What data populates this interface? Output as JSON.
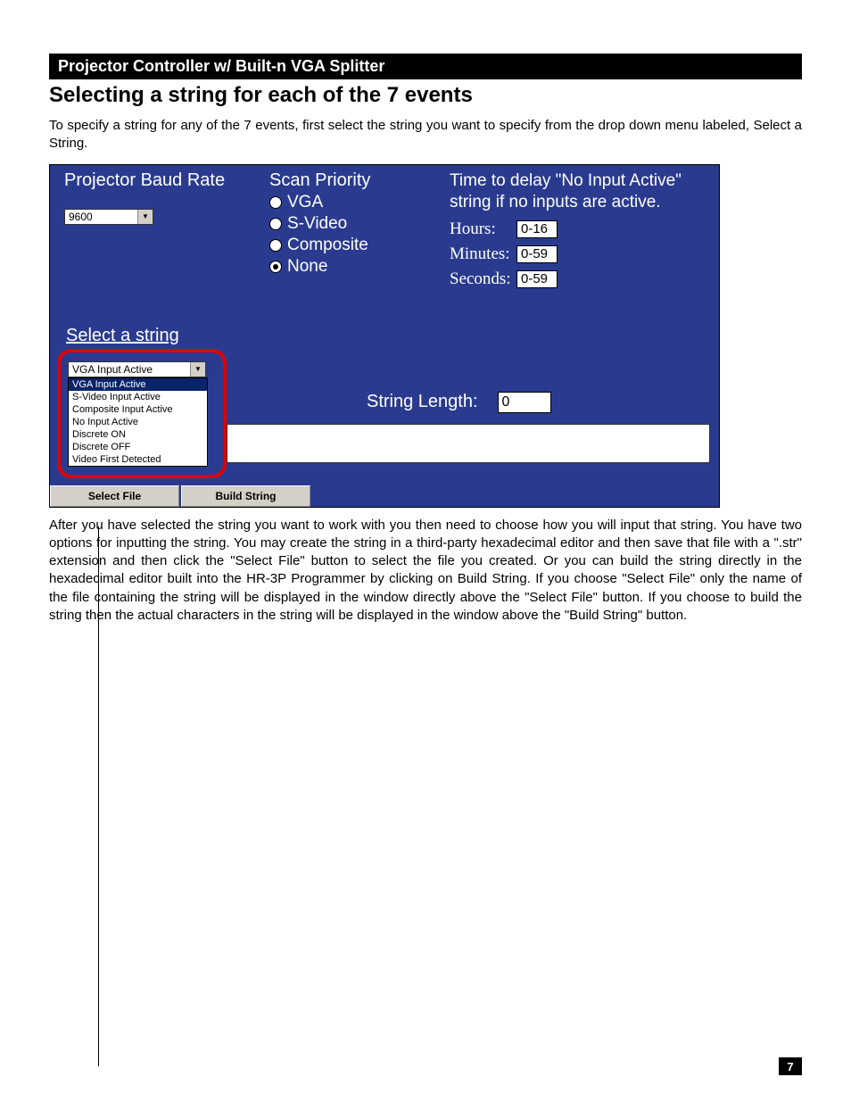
{
  "header": {
    "product_title": "Projector Controller w/ Built-n VGA Splitter",
    "section_heading": "Selecting a string for each of the 7 events"
  },
  "intro_paragraph": "To specify a string for any of the 7 events, first select the string you want to specify from the drop down menu labeled, Select a String.",
  "screenshot": {
    "baud": {
      "label": "Projector Baud Rate",
      "value": "9600"
    },
    "scan": {
      "title": "Scan Priority",
      "options": [
        {
          "label": "VGA",
          "selected": false
        },
        {
          "label": "S-Video",
          "selected": false
        },
        {
          "label": "Composite",
          "selected": false
        },
        {
          "label": "None",
          "selected": true
        }
      ]
    },
    "delay": {
      "line1": "Time to delay \"No Input Active\"",
      "line2": "string if no inputs are active.",
      "rows": [
        {
          "label": "Hours:",
          "value": "0-16"
        },
        {
          "label": "Minutes:",
          "value": "0-59"
        },
        {
          "label": "Seconds:",
          "value": "0-59"
        }
      ]
    },
    "select_string": {
      "label": "Select a string",
      "selected": "VGA Input Active",
      "options": [
        "VGA Input Active",
        "S-Video Input Active",
        "Composite Input Active",
        "No Input Active",
        "Discrete ON",
        "Discrete OFF",
        "Video First Detected"
      ]
    },
    "string_length": {
      "label": "String Length:",
      "value": "0"
    },
    "buttons": {
      "select_file": "Select File",
      "build_string": "Build String"
    }
  },
  "body_paragraph": "After you have selected the string you want to work with you then need to choose how you will input that string. You have two options for inputting the string. You may create the string in a third-party hexadecimal editor and then save that file with a \".str\" extension and then click the \"Select File\" button to select the file you created. Or you can build the string directly in the hexadecimal editor built into the HR-3P Programmer by clicking on Build String. If you choose \"Select File\" only the name of the file containing the string will be displayed in the window directly above the \"Select File\" button. If you choose to build the string then the actual characters in the string will be displayed in the window above the \"Build String\" button.",
  "page_number": "7"
}
